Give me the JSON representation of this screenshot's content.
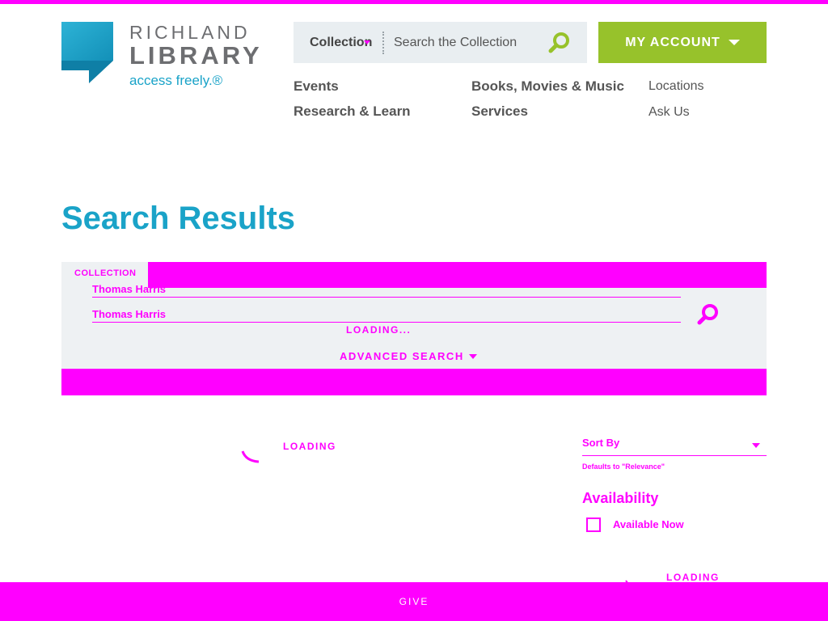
{
  "brand": {
    "line1": "RICHLAND",
    "line2": "LIBRARY",
    "tagline": "access freely.®",
    "colors": {
      "teal": "#1aa3c8",
      "green": "#97c22b",
      "gray": "#6d6e71",
      "magenta": "#ff00ff"
    }
  },
  "header": {
    "search": {
      "scope_label": "Collection",
      "placeholder": "Search the Collection",
      "icon": "search-icon"
    },
    "account_label": "MY ACCOUNT"
  },
  "nav": {
    "primary": [
      {
        "label": "Events"
      },
      {
        "label": "Research & Learn"
      },
      {
        "label": "Books, Movies & Music"
      },
      {
        "label": "Services"
      }
    ],
    "secondary": [
      {
        "label": "Locations"
      },
      {
        "label": "Ask Us"
      }
    ]
  },
  "page": {
    "title": "Search Results"
  },
  "search_panel": {
    "tab_label": "COLLECTION",
    "field1_value": "Thomas Harris",
    "field2_value": "Thomas Harris",
    "loading_text": "LOADING...",
    "advanced_label": "ADVANCED SEARCH"
  },
  "results": {
    "loading_text": "LOADING"
  },
  "sidebar": {
    "sort_label": "Sort By",
    "sort_note": "Defaults to \"Relevance\"",
    "availability_heading": "Availability",
    "available_now_label": "Available Now",
    "loading_text": "LOADING"
  },
  "footer": {
    "give_label": "GIVE"
  }
}
